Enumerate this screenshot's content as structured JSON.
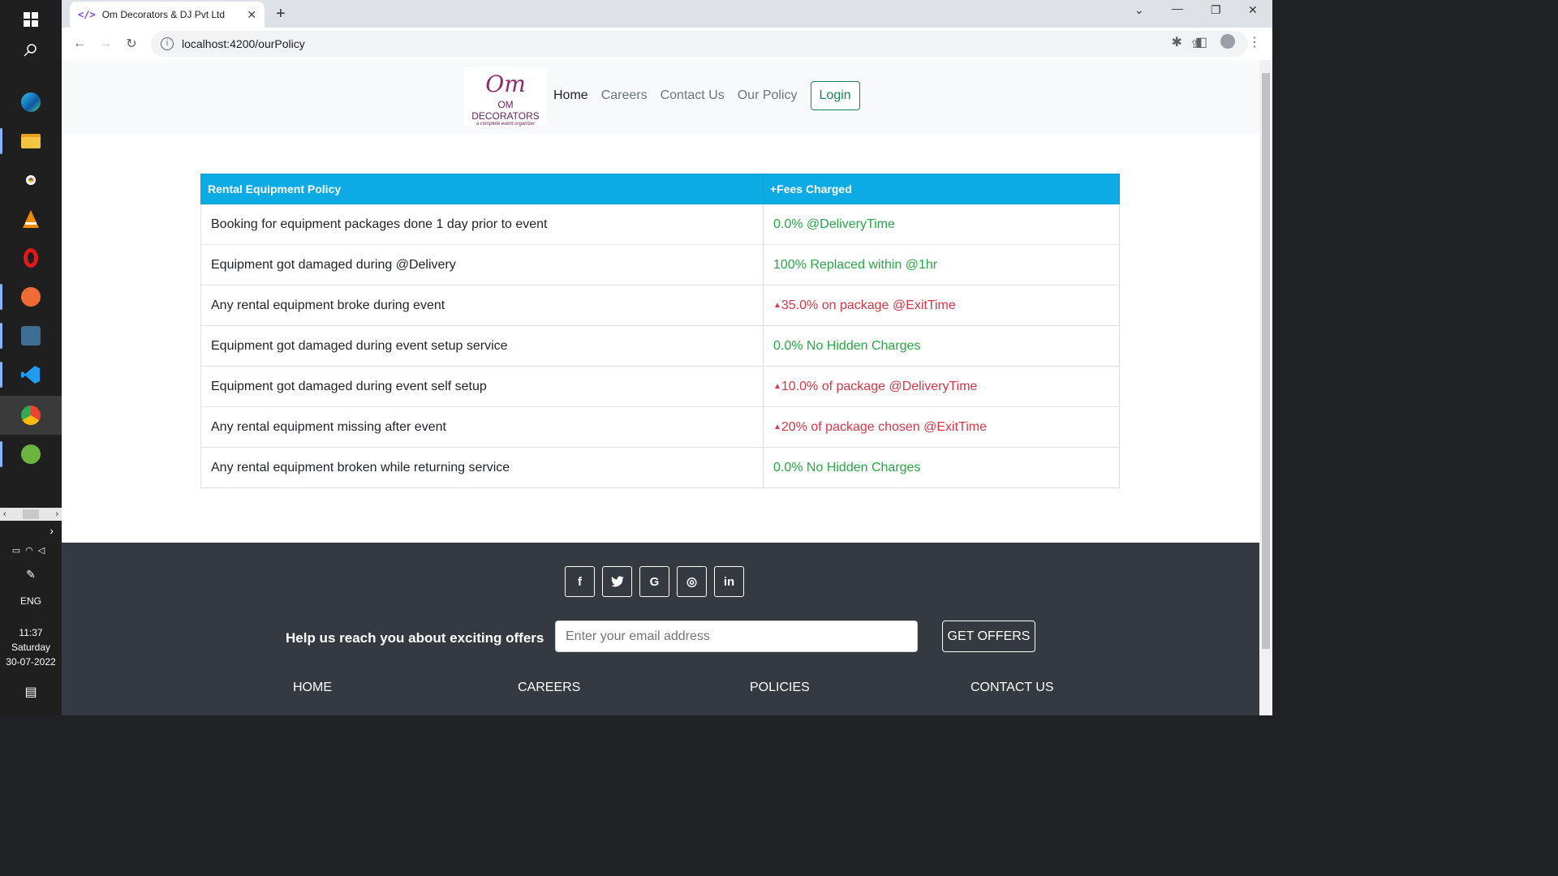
{
  "taskbar": {
    "icons": [
      "windows-icon",
      "search-icon",
      "edge-icon",
      "file-explorer-icon",
      "chrome-icon",
      "vlc-icon",
      "opera-icon",
      "postman-icon",
      "mysql-workbench-icon",
      "vscode-icon",
      "chrome-profile-icon",
      "spring-tool-icon"
    ],
    "language": "ENG",
    "time": "11:37",
    "day": "Saturday",
    "date": "30-07-2022"
  },
  "browser": {
    "tab_title": "Om Decorators & DJ Pvt Ltd",
    "favicon": "</>",
    "url": "localhost:4200/ourPolicy"
  },
  "site": {
    "logo": {
      "mark": "Om",
      "name": "OM DECORATORS",
      "tagline": "a complete event organizer"
    },
    "nav": [
      {
        "label": "Home"
      },
      {
        "label": "Careers"
      },
      {
        "label": "Contact Us"
      },
      {
        "label": "Our Policy"
      }
    ],
    "login_label": "Login"
  },
  "policy_table": {
    "headers": [
      "Rental Equipment Policy",
      "+Fees Charged"
    ],
    "rows": [
      {
        "policy": "Booking for equipment packages done 1 day prior to event",
        "fee": "0.0% @DeliveryTime",
        "status": "good"
      },
      {
        "policy": "Equipment got damaged during @Delivery",
        "fee": "100% Replaced within @1hr",
        "status": "good"
      },
      {
        "policy": "Any rental equipment broke during event",
        "fee": "35.0% on package @ExitTime",
        "status": "bad"
      },
      {
        "policy": "Equipment got damaged during event setup service",
        "fee": "0.0% No Hidden Charges",
        "status": "good"
      },
      {
        "policy": "Equipment got damaged during event self setup",
        "fee": "10.0% of package @DeliveryTime",
        "status": "bad"
      },
      {
        "policy": "Any rental equipment missing after event",
        "fee": "20% of package chosen @ExitTime",
        "status": "bad"
      },
      {
        "policy": "Any rental equipment broken while returning service",
        "fee": "0.0% No Hidden Charges",
        "status": "good"
      }
    ],
    "colors": {
      "header_bg": "#0dabe6",
      "good": "#28a745",
      "bad": "#dc3545"
    }
  },
  "footer": {
    "social": [
      {
        "name": "facebook-icon",
        "glyph": "f"
      },
      {
        "name": "twitter-icon",
        "glyph": "t"
      },
      {
        "name": "google-icon",
        "glyph": "G"
      },
      {
        "name": "instagram-icon",
        "glyph": "◎"
      },
      {
        "name": "linkedin-icon",
        "glyph": "in"
      }
    ],
    "offer_text": "Help us reach you about exciting offers",
    "email_placeholder": "Enter your email address",
    "get_offers_label": "GET OFFERS",
    "links": [
      "HOME",
      "CAREERS",
      "POLICIES",
      "CONTACT US"
    ]
  }
}
